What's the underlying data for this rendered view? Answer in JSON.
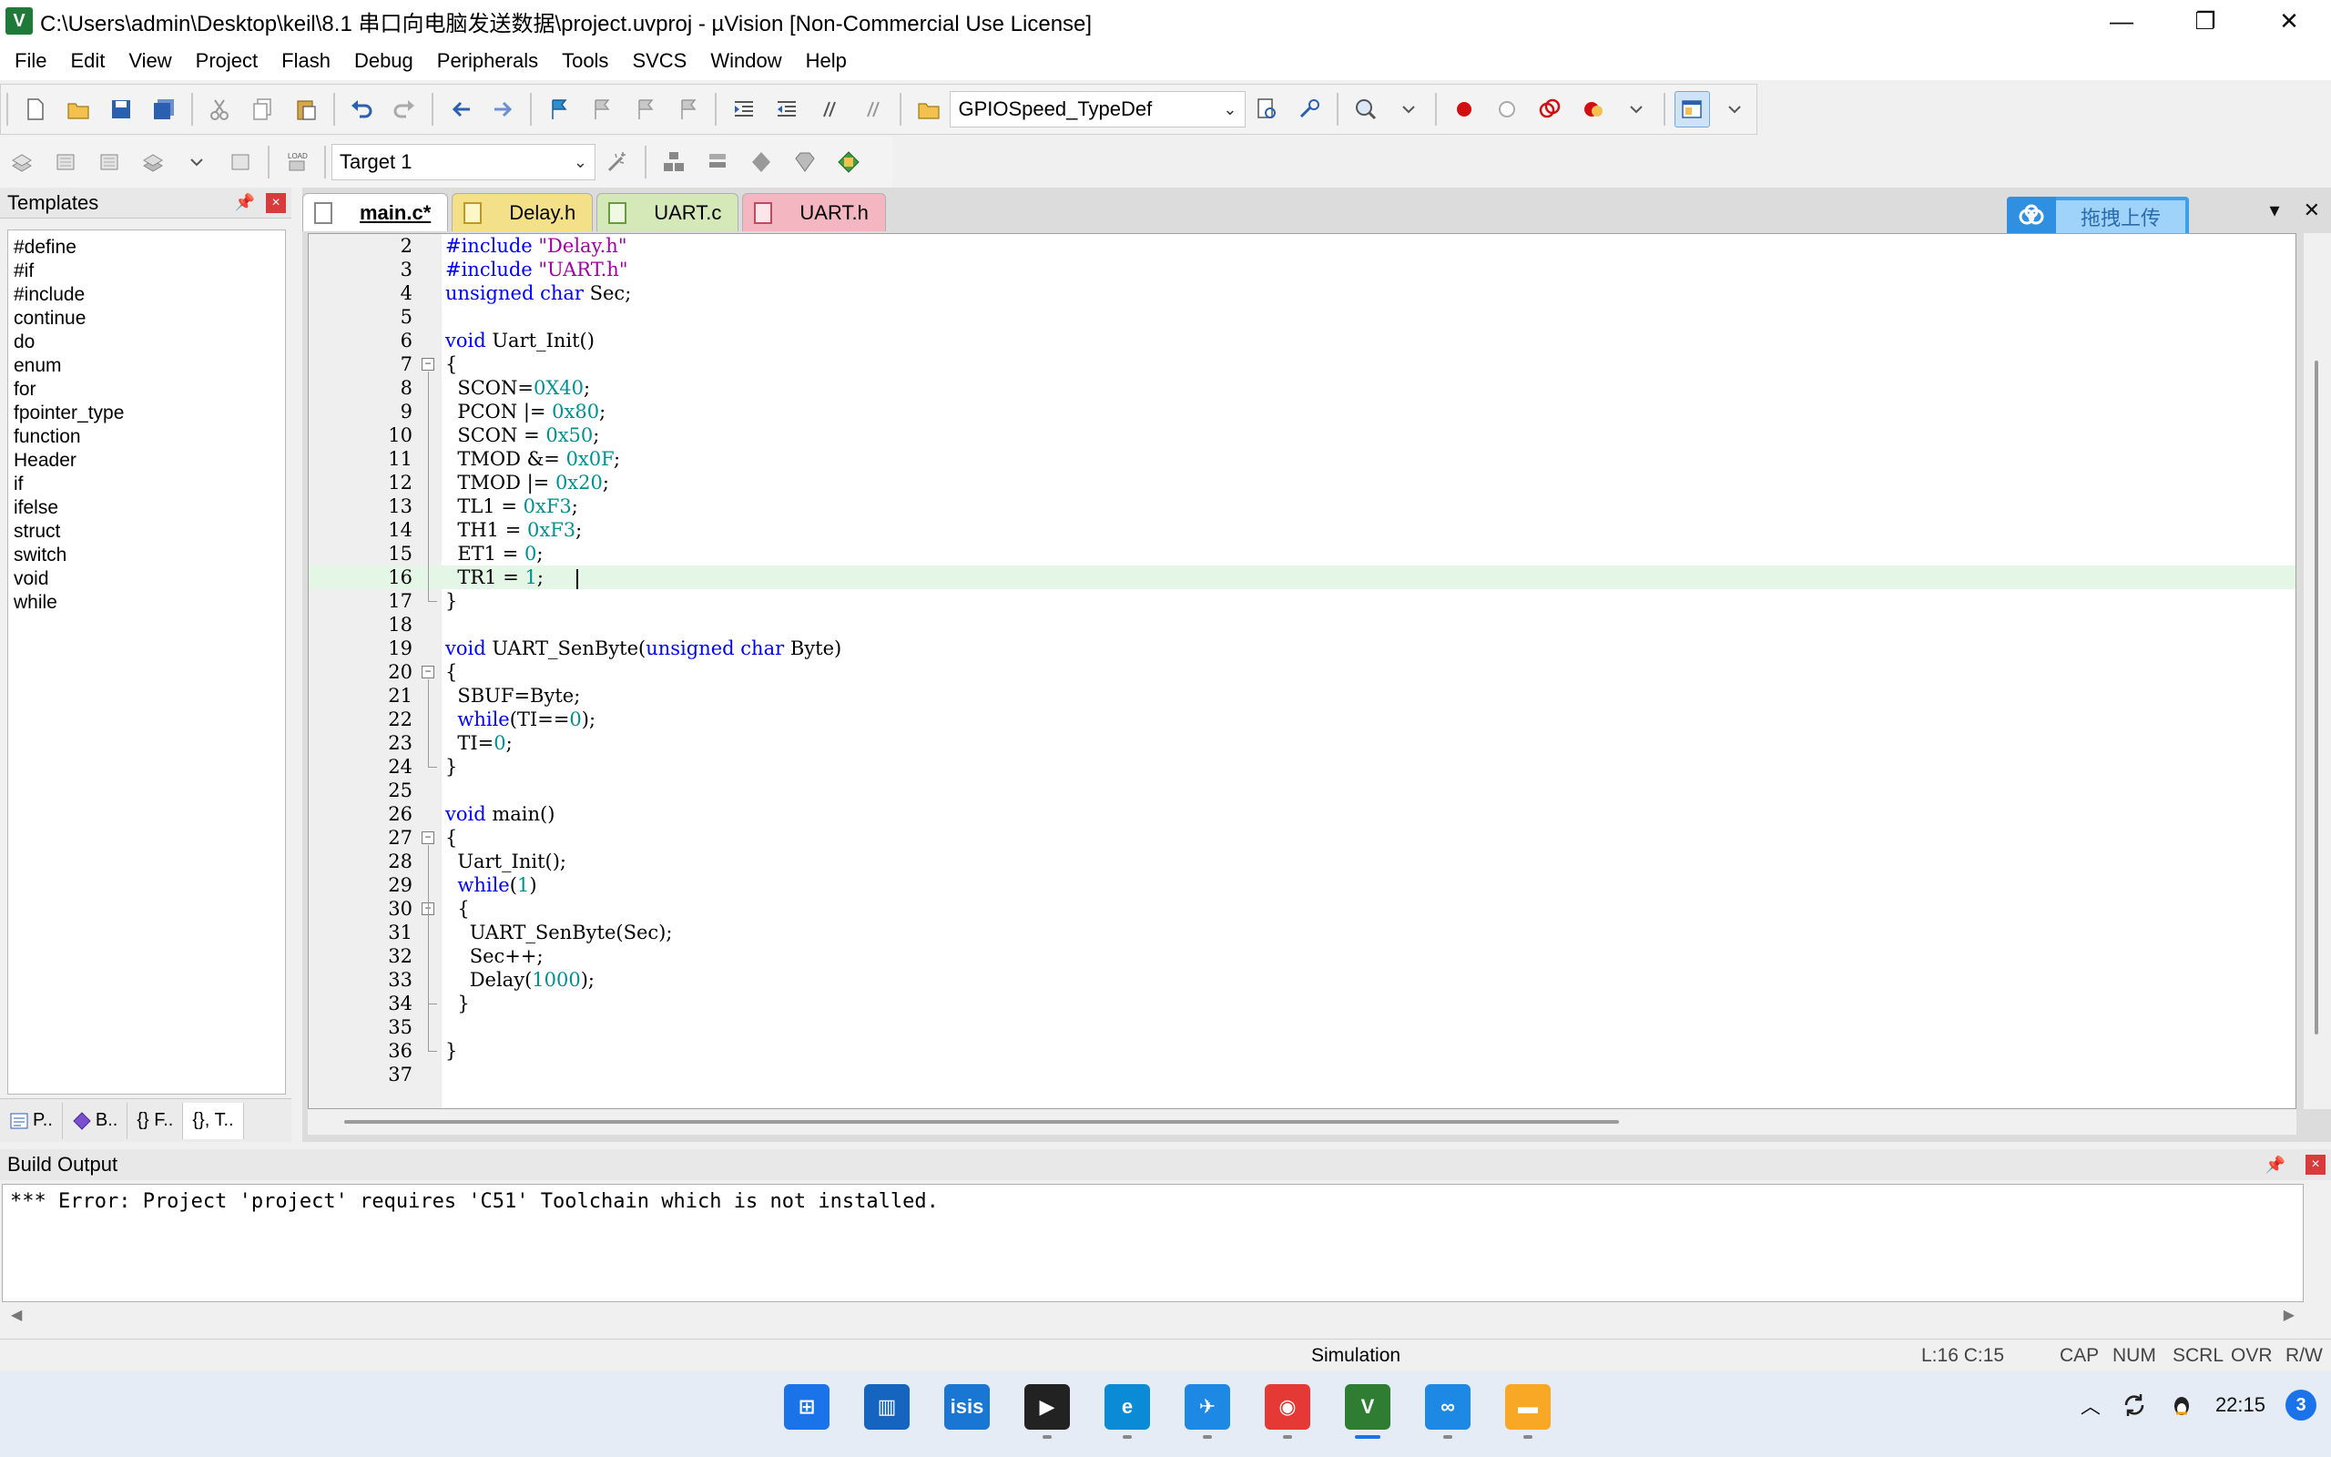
{
  "window": {
    "title": "C:\\Users\\admin\\Desktop\\keil\\8.1 串口向电脑发送数据\\project.uvproj - µVision  [Non-Commercial Use License]",
    "app_icon": "V",
    "minimize": "—",
    "maximize": "❐",
    "close": "✕"
  },
  "menu": [
    "File",
    "Edit",
    "View",
    "Project",
    "Flash",
    "Debug",
    "Peripherals",
    "Tools",
    "SVCS",
    "Window",
    "Help"
  ],
  "toolbar": {
    "find_combo": "GPIOSpeed_TypeDef",
    "target_combo": "Target 1",
    "combo_arrow": "⌄"
  },
  "templates": {
    "title": "Templates",
    "pin": "📌",
    "close": "×",
    "items": [
      "#define",
      "#if",
      "#include",
      "continue",
      "do",
      "enum",
      "for",
      "fpointer_type",
      "function",
      "Header",
      "if",
      "ifelse",
      "struct",
      "switch",
      "void",
      "while"
    ],
    "tabs": [
      "P..",
      "B..",
      "{} F..",
      "{}, T.."
    ]
  },
  "editor": {
    "tabs": [
      "main.c*",
      "Delay.h",
      "UART.c",
      "UART.h"
    ],
    "upload_label": "拖拽上传",
    "dropdown": "▾",
    "close": "✕",
    "lines": [
      {
        "n": "2",
        "t": "#include \"Delay.h\""
      },
      {
        "n": "3",
        "t": "#include \"UART.h\""
      },
      {
        "n": "4",
        "t": "unsigned char Sec;"
      },
      {
        "n": "5",
        "t": ""
      },
      {
        "n": "6",
        "t": "void Uart_Init()"
      },
      {
        "n": "7",
        "t": "{"
      },
      {
        "n": "8",
        "t": "  SCON=0X40;"
      },
      {
        "n": "9",
        "t": "  PCON |= 0x80;"
      },
      {
        "n": "10",
        "t": "  SCON = 0x50;"
      },
      {
        "n": "11",
        "t": "  TMOD &= 0x0F;"
      },
      {
        "n": "12",
        "t": "  TMOD |= 0x20;"
      },
      {
        "n": "13",
        "t": "  TL1 = 0xF3;"
      },
      {
        "n": "14",
        "t": "  TH1 = 0xF3;"
      },
      {
        "n": "15",
        "t": "  ET1 = 0;"
      },
      {
        "n": "16",
        "t": "  TR1 = 1;"
      },
      {
        "n": "17",
        "t": "}"
      },
      {
        "n": "18",
        "t": ""
      },
      {
        "n": "19",
        "t": "void UART_SenByte(unsigned char Byte)"
      },
      {
        "n": "20",
        "t": "{"
      },
      {
        "n": "21",
        "t": "  SBUF=Byte;"
      },
      {
        "n": "22",
        "t": "  while(TI==0);"
      },
      {
        "n": "23",
        "t": "  TI=0;"
      },
      {
        "n": "24",
        "t": "}"
      },
      {
        "n": "25",
        "t": ""
      },
      {
        "n": "26",
        "t": "void main()"
      },
      {
        "n": "27",
        "t": "{"
      },
      {
        "n": "28",
        "t": "  Uart_Init();"
      },
      {
        "n": "29",
        "t": "  while(1)"
      },
      {
        "n": "30",
        "t": "  {"
      },
      {
        "n": "31",
        "t": "    UART_SenByte(Sec);"
      },
      {
        "n": "32",
        "t": "    Sec++;"
      },
      {
        "n": "33",
        "t": "    Delay(1000);"
      },
      {
        "n": "34",
        "t": "  }"
      },
      {
        "n": "35",
        "t": ""
      },
      {
        "n": "36",
        "t": "}"
      },
      {
        "n": "37",
        "t": ""
      }
    ],
    "current_line": "16"
  },
  "build": {
    "title": "Build Output",
    "pin": "📌",
    "close": "×",
    "message": "*** Error: Project 'project' requires 'C51' Toolchain which is not installed.",
    "scroll_left": "◀",
    "scroll_right": "▶"
  },
  "status": {
    "mode": "Simulation",
    "position": "L:16 C:15",
    "cap": "CAP",
    "num": "NUM",
    "scrl": "SCRL",
    "ovr": "OVR",
    "rw": "R/W"
  },
  "taskbar": {
    "clock": "22:15",
    "notification_count": "3",
    "tray_chevron": "︿",
    "apps": [
      {
        "name": "start",
        "color": "#1a73e8",
        "glyph": "⊞"
      },
      {
        "name": "widgets",
        "color": "#1565c0",
        "glyph": "▥"
      },
      {
        "name": "isis",
        "color": "#1976d2",
        "glyph": "isis"
      },
      {
        "name": "media",
        "color": "#222222",
        "glyph": "▶"
      },
      {
        "name": "edge",
        "color": "#0b8bd6",
        "glyph": "e"
      },
      {
        "name": "feishu",
        "color": "#1e88e5",
        "glyph": "✈"
      },
      {
        "name": "chrome",
        "color": "#e53935",
        "glyph": "◉"
      },
      {
        "name": "keil",
        "color": "#2e7d32",
        "glyph": "V"
      },
      {
        "name": "baidu-netdisk",
        "color": "#1e88e5",
        "glyph": "∞"
      },
      {
        "name": "explorer",
        "color": "#f9a825",
        "glyph": "▬"
      }
    ]
  },
  "colors": {
    "keyword": "#0000ff",
    "number": "#009090",
    "string": "#a000a0",
    "current_line_bg": "#e4f7e6"
  }
}
